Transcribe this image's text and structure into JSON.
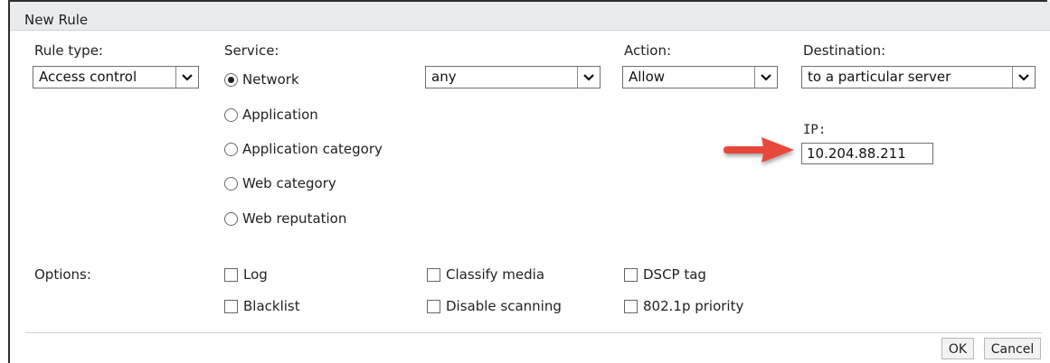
{
  "dialog": {
    "title": "New Rule"
  },
  "rule_type": {
    "label": "Rule type:",
    "value": "Access control"
  },
  "service": {
    "label": "Service:",
    "options": [
      "Network",
      "Application",
      "Application category",
      "Web category",
      "Web reputation"
    ],
    "selected": "Network",
    "network_value": "any"
  },
  "action": {
    "label": "Action:",
    "value": "Allow"
  },
  "destination": {
    "label": "Destination:",
    "value": "to a particular server"
  },
  "ip": {
    "label": "IP:",
    "value": "10.204.88.211"
  },
  "options": {
    "label": "Options:",
    "checkboxes": [
      "Log",
      "Blacklist",
      "Classify media",
      "Disable scanning",
      "DSCP tag",
      "802.1p priority"
    ]
  },
  "buttons": {
    "ok": "OK",
    "cancel": "Cancel"
  },
  "colors": {
    "arrow": "#e8473a",
    "header_bg": "#e8ecef"
  },
  "icons": {
    "dropdown": "chevron-down-icon",
    "pointer": "red-arrow-icon"
  }
}
